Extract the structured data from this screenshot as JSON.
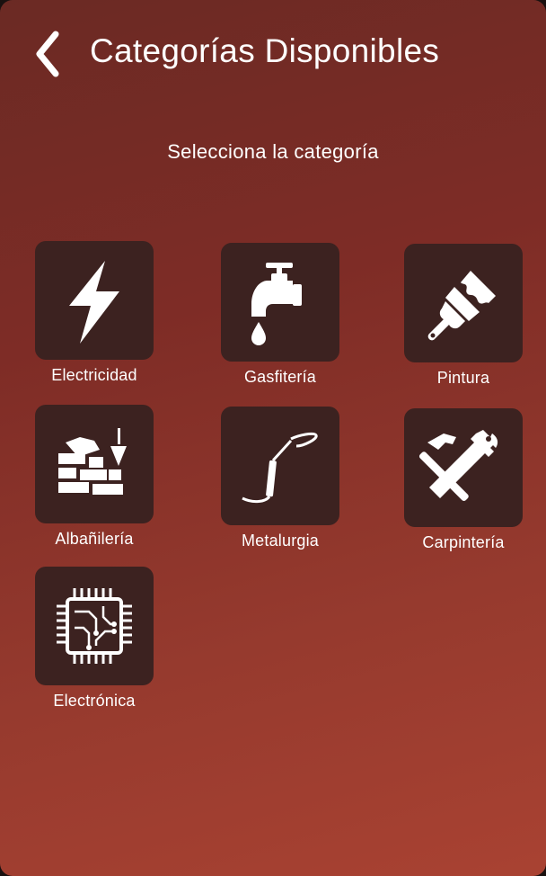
{
  "header": {
    "back_icon": "chevron-left-icon",
    "title": "Categorías Disponibles"
  },
  "subtitle": "Selecciona la categoría",
  "categories": [
    {
      "label": "Electricidad",
      "icon": "lightning-bolt-icon"
    },
    {
      "label": "Gasfitería",
      "icon": "water-faucet-icon"
    },
    {
      "label": "Pintura",
      "icon": "paint-brush-icon"
    },
    {
      "label": "Albañilería",
      "icon": "brick-wall-trowel-icon"
    },
    {
      "label": "Metalurgia",
      "icon": "welding-torch-icon"
    },
    {
      "label": "Carpintería",
      "icon": "hammer-saw-icon"
    },
    {
      "label": "Electrónica",
      "icon": "microchip-icon"
    }
  ],
  "colors": {
    "background_top": "#6b2a24",
    "background_bottom": "#a94232",
    "tile": "#3c2220",
    "text": "#ffffff"
  }
}
